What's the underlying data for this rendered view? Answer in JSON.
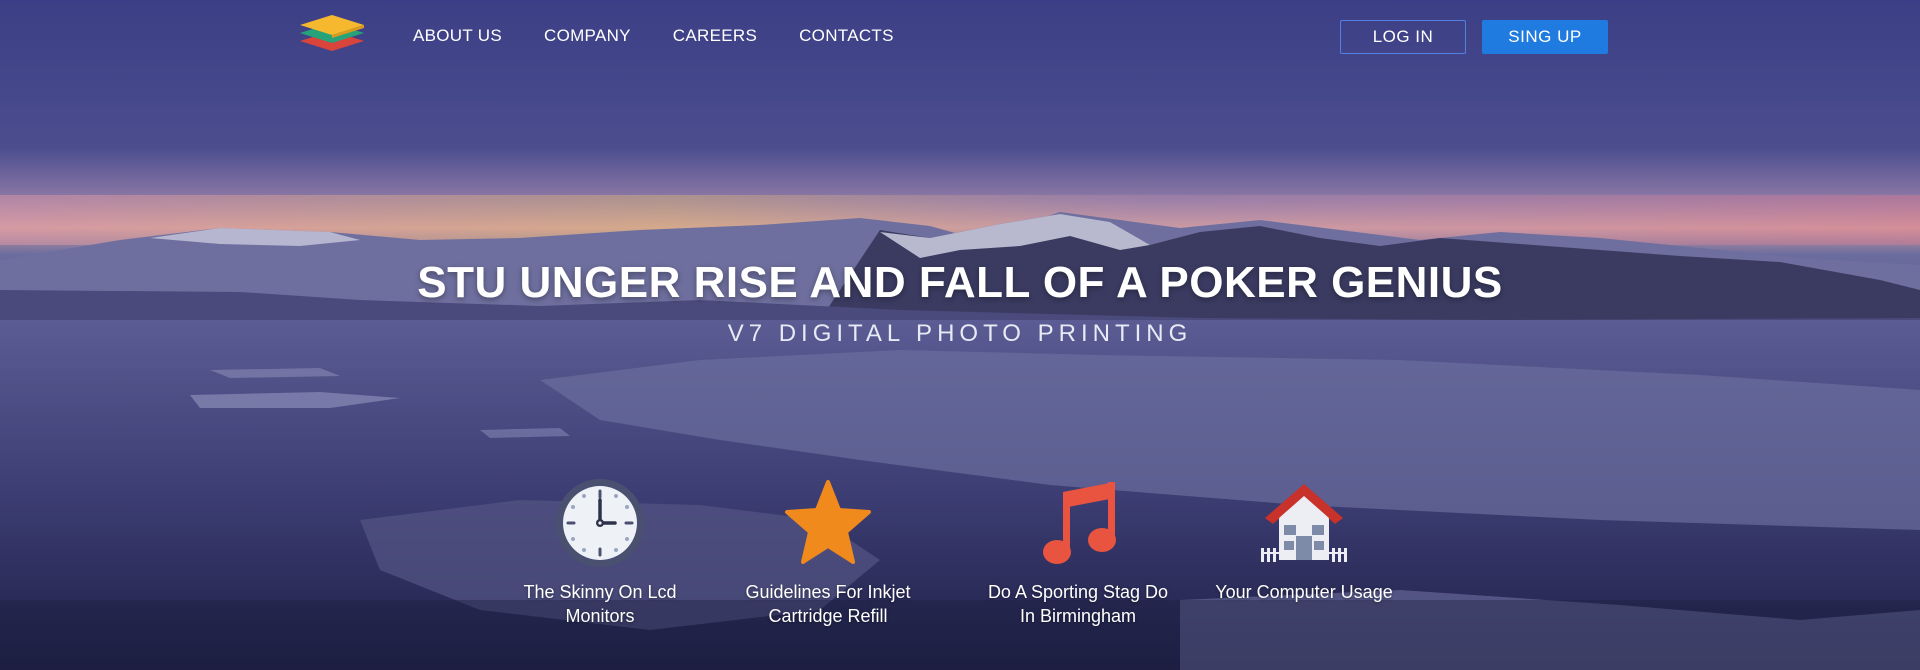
{
  "nav": {
    "menu": [
      "ABOUT US",
      "COMPANY",
      "CAREERS",
      "CONTACTS"
    ],
    "login_label": "LOG IN",
    "signup_label": "SING UP"
  },
  "hero": {
    "title": "STU UNGER RISE AND FALL OF A POKER GENIUS",
    "subtitle": "V7 DIGITAL PHOTO PRINTING"
  },
  "features": [
    {
      "icon": "clock-icon",
      "label_line1": "The Skinny On Lcd",
      "label_line2": "Monitors"
    },
    {
      "icon": "star-icon",
      "label_line1": "Guidelines For Inkjet",
      "label_line2": "Cartridge Refill"
    },
    {
      "icon": "music-note-icon",
      "label_line1": "Do A Sporting Stag Do",
      "label_line2": "In Birmingham"
    },
    {
      "icon": "house-icon",
      "label_line1": "Your Computer Usage",
      "label_line2": ""
    }
  ],
  "colors": {
    "primary_button": "#1f7be0",
    "star": "#f08a1c",
    "music": "#e8543f",
    "roof": "#c8322b",
    "logo_top": "#f5b82e",
    "logo_mid": "#27a37a",
    "logo_bottom": "#d9443b"
  }
}
